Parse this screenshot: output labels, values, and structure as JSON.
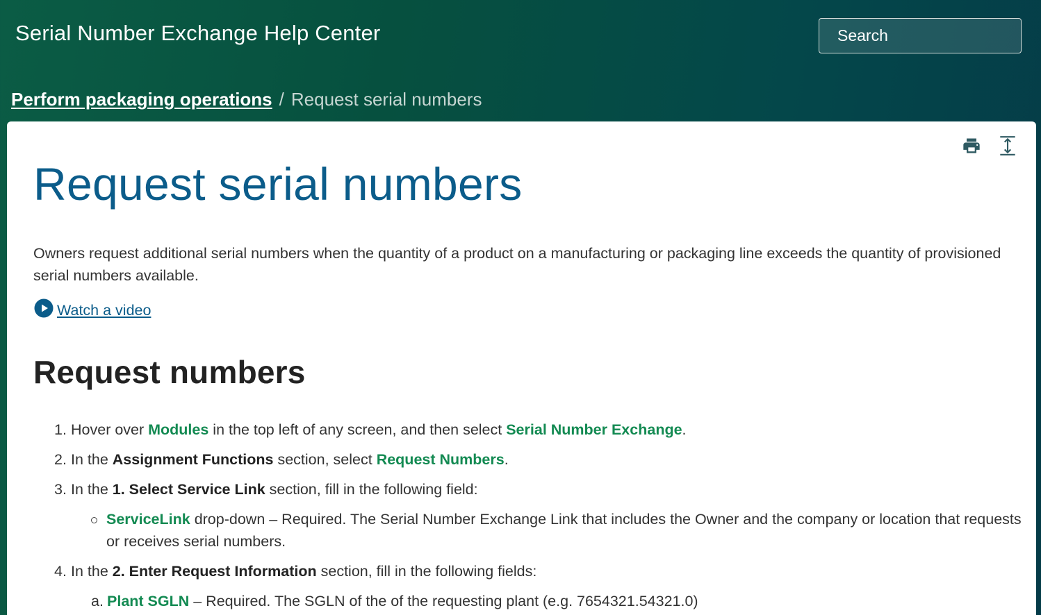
{
  "header": {
    "title": "Serial Number Exchange Help Center",
    "search_placeholder": "Search"
  },
  "breadcrumb": {
    "parent": "Perform packaging operations",
    "separator": "/",
    "current": "Request serial numbers"
  },
  "toolbar": {
    "print_icon": "print-icon",
    "expand_icon": "expand-collapse-icon"
  },
  "article": {
    "title": "Request serial numbers",
    "intro": "Owners request additional serial numbers when the quantity of a product on a manufacturing or packaging line exceeds the quantity of provisioned serial numbers available.",
    "video_label": "Watch a video",
    "section_title": "Request numbers",
    "steps": [
      {
        "num": "1.",
        "t1": "Hover over ",
        "g1": "Modules",
        "t2": " in the top left of any screen, and then select ",
        "g2": "Serial Number Exchange",
        "t3": "."
      },
      {
        "num": "2.",
        "t1": "In the ",
        "b1": "Assignment Functions",
        "t2": " section, select ",
        "g1": "Request Numbers",
        "t3": "."
      },
      {
        "num": "3.",
        "t1": "In the ",
        "b1": "1. Select Service Link",
        "t2": " section, fill in the following field:",
        "sub": {
          "g1": "ServiceLink",
          "text": " drop-down – Required. The Serial Number Exchange Link that includes the Owner and the company or location that requests or receives serial numbers."
        }
      },
      {
        "num": "4.",
        "t1": "In the ",
        "b1": "2. Enter Request Information",
        "t2": " section, fill in the following fields:",
        "sub": {
          "marker": "a.",
          "g1": "Plant SGLN",
          "text": " – Required. The SGLN of the of the requesting plant (e.g. 7654321.54321.0)"
        }
      }
    ]
  },
  "colors": {
    "header_gradient_start": "#0b5c45",
    "header_gradient_end": "#053b48",
    "title_blue": "#0b5c8a",
    "link_green": "#138a52",
    "icon_teal": "#2f5a62"
  }
}
